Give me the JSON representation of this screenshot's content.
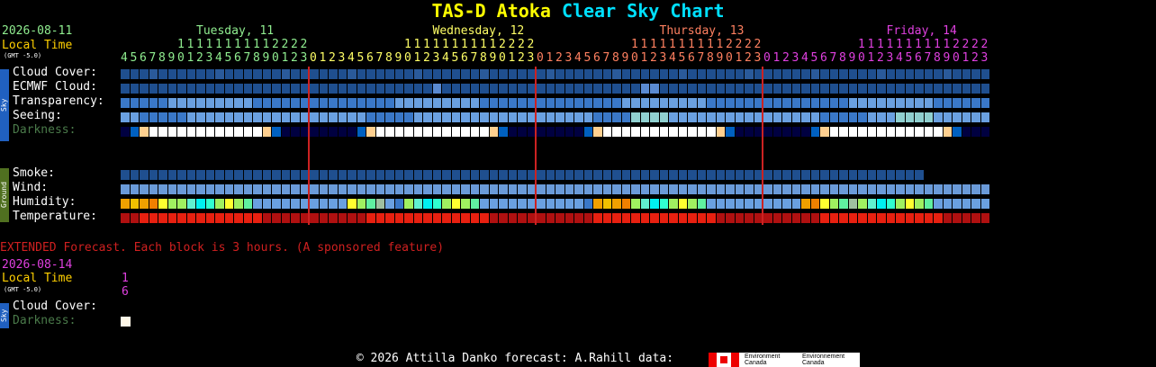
{
  "title": {
    "part1": "TAS-D Atoka",
    "part2": "Clear Sky Chart"
  },
  "date_left": "2026-08-11",
  "local_time_label": "Local Time",
  "gmt_label": "(GMT -5.0)",
  "day_headers": [
    {
      "text": "Tuesday, 11",
      "color": "#90ee90"
    },
    {
      "text": "Wednesday, 12",
      "color": "#ffff66"
    },
    {
      "text": "Thursday, 13",
      "color": "#ff8060"
    },
    {
      "text": "Friday, 14",
      "color": "#e040e0"
    }
  ],
  "hours": [
    4,
    5,
    6,
    7,
    8,
    9,
    10,
    11,
    12,
    13,
    14,
    15,
    16,
    17,
    18,
    19,
    20,
    21,
    22,
    23,
    0,
    1,
    2,
    3,
    4,
    5,
    6,
    7,
    8,
    9,
    10,
    11,
    12,
    13,
    14,
    15,
    16,
    17,
    18,
    19,
    20,
    21,
    22,
    23,
    0,
    1,
    2,
    3,
    4,
    5,
    6,
    7,
    8,
    9,
    10,
    11,
    12,
    13,
    14,
    15,
    16,
    17,
    18,
    19,
    20,
    21,
    22,
    23,
    0,
    1,
    2,
    3,
    4,
    5,
    6,
    7,
    8,
    9,
    10,
    11,
    12,
    13,
    14,
    15,
    16,
    17,
    18,
    19,
    20,
    21,
    22,
    23
  ],
  "sky_rows": [
    {
      "label": "Cloud Cover:"
    },
    {
      "label": "ECMWF Cloud:"
    },
    {
      "label": "Transparency:"
    },
    {
      "label": "Seeing:"
    },
    {
      "label": "Darkness:"
    }
  ],
  "ground_rows": [
    {
      "label": "Smoke:"
    },
    {
      "label": "Wind:"
    },
    {
      "label": "Humidity:"
    },
    {
      "label": "Temperature:"
    }
  ],
  "sky_side_label": "Sky",
  "ground_side_label": "Ground",
  "extended_text": "EXTENDED Forecast. Each block is 3 hours. (A sponsored feature)",
  "ext_date": "2026-08-14",
  "ext_local_time_label": "Local Time",
  "ext_gmt_label": "(GMT -5.0)",
  "ext_hour_top": "1",
  "ext_hour_bottom": "6",
  "ext_rows": [
    {
      "label": "Cloud Cover:"
    },
    {
      "label": "Darkness:"
    }
  ],
  "footer_text": "© 2026 Attilla Danko  forecast: A.Rahill  data:",
  "env_text_en": "Environment Canada",
  "env_text_fr": "Environnement Canada",
  "colors": {
    "cloud": "#1f4f8f",
    "cloud_alt": "#2a5a9a",
    "transp": "#3a78c8",
    "seeing": "#6aa0e0",
    "seeing_good": "#90d0d0",
    "smoke": "#1f4f8f",
    "wind": "#6a9ad8",
    "temp": "#e82010",
    "temp_dark": "#b01010",
    "dark_night": "#000040",
    "dark_twilight": "#0060c0",
    "dark_day": "#ffffff",
    "darkness_label": "#4a7a4a",
    "extended_red": "#d02020"
  }
}
